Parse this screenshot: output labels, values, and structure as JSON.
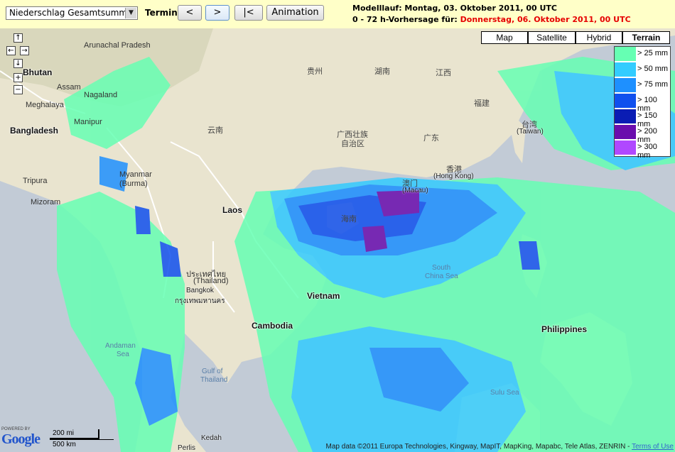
{
  "toolbar": {
    "product_select": "Niederschlag Gesamtsumme",
    "termin_label": "Termin:",
    "prev_label": "<",
    "next_label": ">",
    "first_label": "|<",
    "animation_label": "Animation",
    "modelrun_text": "Modelllauf: Montag, 03. Oktober 2011, 00 UTC",
    "forecast_prefix": "0 - 72 h-Vorhersage für: ",
    "forecast_date": "Donnerstag, 06. Oktober 2011, 00 UTC"
  },
  "map_types": [
    "Map",
    "Satellite",
    "Hybrid",
    "Terrain"
  ],
  "active_map_type": "Terrain",
  "legend": [
    {
      "label": "> 25 mm",
      "color": "#66ffb3"
    },
    {
      "label": "> 50 mm",
      "color": "#33ccff"
    },
    {
      "label": "> 75 mm",
      "color": "#1e90ff"
    },
    {
      "label": "> 100 mm",
      "color": "#1050ee"
    },
    {
      "label": "> 150 mm",
      "color": "#0a1cb4"
    },
    {
      "label": "> 200 mm",
      "color": "#6a0dad"
    },
    {
      "label": "> 300 mm",
      "color": "#b048ff"
    }
  ],
  "nav_controls": {
    "up": "↑",
    "left": "←",
    "right": "→",
    "down": "↓",
    "zoom_in": "+",
    "zoom_out": "−"
  },
  "places": {
    "bhutan": "Bhutan",
    "assam": "Assam",
    "nagaland": "Nagaland",
    "arunachal": "Arunachal Pradesh",
    "meghalaya": "Meghalaya",
    "manipur": "Manipur",
    "bangladesh": "Bangladesh",
    "tripura": "Tripura",
    "mizoram": "Mizoram",
    "myanmar": "Myanmar",
    "burma": "(Burma)",
    "laos": "Laos",
    "thailand_th": "ประเทศไทย",
    "thailand": "(Thailand)",
    "bangkok": "Bangkok",
    "bangkok_th": "กรุงเทพมหานคร",
    "cambodia": "Cambodia",
    "vietnam": "Vietnam",
    "philippines": "Philippines",
    "guizhou": "贵州",
    "hunan": "湖南",
    "jiangxi": "江西",
    "fujian": "福建",
    "yunnan": "云南",
    "guangxi": "广西壮族",
    "guangxi2": "自治区",
    "guangdong": "广东",
    "hongkong_zh": "香港",
    "hongkong": "(Hong Kong)",
    "macau_zh": "澳门",
    "macau": "(Macau)",
    "hainan": "海南",
    "taiwan_zh": "台湾",
    "taiwan": "(Taiwan)",
    "scs1": "South",
    "scs2": "China Sea",
    "andaman1": "Andaman",
    "andaman2": "Sea",
    "gulf1": "Gulf of",
    "gulf2": "Thailand",
    "sulu": "Sulu Sea",
    "kedah": "Kedah",
    "kedah2": "Perlis"
  },
  "scale": {
    "mi": "200 mi",
    "km": "500 km"
  },
  "branding": {
    "powered": "POWERED BY",
    "google": "Google"
  },
  "credits": "Map data ©2011 Europa Technologies, Kingway, MapIT, MapKing, Mapabc, Tele Atlas, ZENRIN - ",
  "terms": "Terms of Use"
}
